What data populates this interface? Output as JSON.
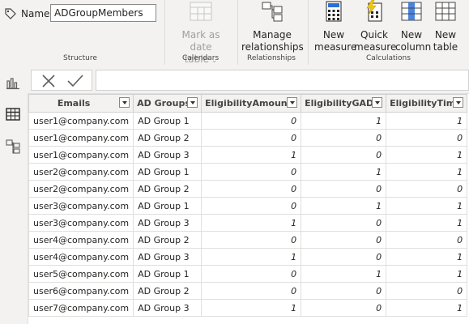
{
  "ribbon": {
    "name_label": "Name",
    "name_value": "ADGroupMembers",
    "groups": {
      "structure": "Structure",
      "calendars": "Calendars",
      "relationships": "Relationships",
      "calculations": "Calculations"
    },
    "buttons": {
      "mark_as_date_line1": "Mark as date",
      "mark_as_date_line2": "table",
      "manage_rel_line1": "Manage",
      "manage_rel_line2": "relationships",
      "new_measure_line1": "New",
      "new_measure_line2": "measure",
      "quick_measure_line1": "Quick",
      "quick_measure_line2": "measure",
      "new_column_line1": "New",
      "new_column_line2": "column",
      "new_table_line1": "New",
      "new_table_line2": "table"
    },
    "icons": [
      "tag-icon",
      "calendar-icon",
      "relationships-icon",
      "calculator-icon",
      "lightning-calculator-icon",
      "column-icon",
      "table-icon"
    ]
  },
  "leftrail": {
    "icons": [
      "report-view-icon",
      "data-view-icon",
      "model-view-icon"
    ]
  },
  "formula_bar": {
    "icons": [
      "cancel-x-icon",
      "commit-check-icon"
    ],
    "value": ""
  },
  "table": {
    "columns": [
      "Emails",
      "AD Groups",
      "EligibilityAmounts",
      "EligibilityGADE",
      "EligibilityTime"
    ],
    "rows": [
      [
        "user1@company.com",
        "AD Group 1",
        "0",
        "1",
        "1"
      ],
      [
        "user1@company.com",
        "AD Group 2",
        "0",
        "0",
        "0"
      ],
      [
        "user1@company.com",
        "AD Group 3",
        "1",
        "0",
        "1"
      ],
      [
        "user2@company.com",
        "AD Group 1",
        "0",
        "1",
        "1"
      ],
      [
        "user2@company.com",
        "AD Group 2",
        "0",
        "0",
        "0"
      ],
      [
        "user3@company.com",
        "AD Group 1",
        "0",
        "1",
        "1"
      ],
      [
        "user3@company.com",
        "AD Group 3",
        "1",
        "0",
        "1"
      ],
      [
        "user4@company.com",
        "AD Group 2",
        "0",
        "0",
        "0"
      ],
      [
        "user4@company.com",
        "AD Group 3",
        "1",
        "0",
        "1"
      ],
      [
        "user5@company.com",
        "AD Group 1",
        "0",
        "1",
        "1"
      ],
      [
        "user6@company.com",
        "AD Group 2",
        "0",
        "0",
        "0"
      ],
      [
        "user7@company.com",
        "AD Group 3",
        "1",
        "0",
        "1"
      ]
    ]
  },
  "colors": {
    "ribbon_bg": "#f3f2f1",
    "accent_blue": "#2b6fd6",
    "accent_yellow": "#f2c811",
    "grid_border": "#e1dfdd"
  }
}
